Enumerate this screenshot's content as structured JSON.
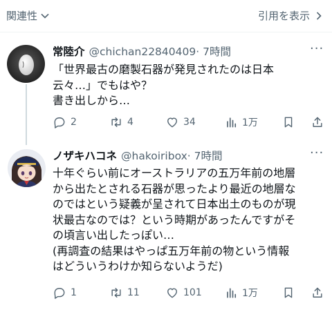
{
  "topbar": {
    "related_label": "関連性",
    "quote_label": "引用を表示"
  },
  "posts": [
    {
      "name": "常陸介",
      "handle": "@chichan22840409",
      "time": "· 7時間",
      "lines": [
        "「世界最古の磨製石器が発見されたのは日本",
        "云々…」でもはや？",
        "書き出しから…"
      ],
      "replies": "2",
      "reposts": "4",
      "likes": "34",
      "views": "1万"
    },
    {
      "name": "ノザキハコネ",
      "handle": "@hakoiribox",
      "time": "· 7時間",
      "lines": [
        "十年ぐらい前にオーストラリアの五万年前の地層",
        "から出たとされる石器が思ったより最近の地層な",
        "のではという疑義が呈されて日本出土のものが現",
        "状最古なのでは？という時期があったんですがそ",
        "の頃言い出したっぽい…",
        "(再調査の結果はやっぱ五万年前の物という情報",
        "はどういうわけか知らないようだ)"
      ],
      "replies": "1",
      "reposts": "11",
      "likes": "101",
      "views": "1万"
    }
  ]
}
